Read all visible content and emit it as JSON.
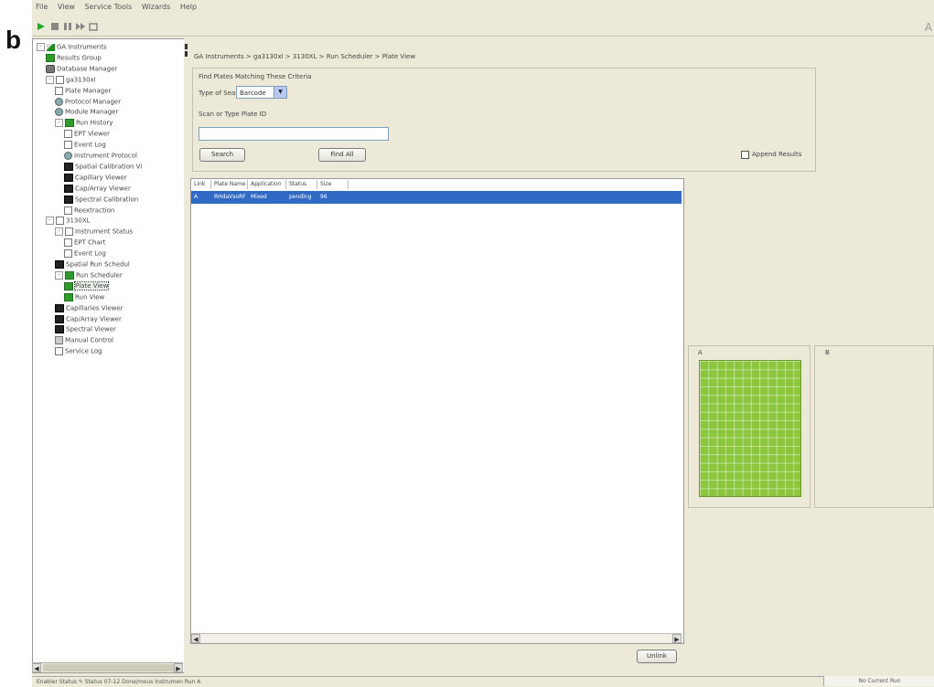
{
  "figure_label": "b",
  "menu": [
    "File",
    "View",
    "Service Tools",
    "Wizards",
    "Help"
  ],
  "toolbar": {
    "brand": "A",
    "icons": [
      "play-icon",
      "stop-icon",
      "pause-icon",
      "skip-icon",
      "clear-icon"
    ]
  },
  "tree": [
    {
      "label": "GA Instruments",
      "level": 0,
      "exp": "-",
      "icon": "tri"
    },
    {
      "label": "Results Group",
      "level": 1,
      "icon": "grn"
    },
    {
      "label": "Database Manager",
      "level": 1,
      "icon": "db"
    },
    {
      "label": "ga3130xl",
      "level": 1,
      "exp": "-",
      "icon": "doc"
    },
    {
      "label": "Plate Manager",
      "level": 2,
      "icon": "doc"
    },
    {
      "label": "Protocol Manager",
      "level": 2,
      "icon": "gear"
    },
    {
      "label": "Module Manager",
      "level": 2,
      "icon": "gear"
    },
    {
      "label": "Run History",
      "level": 2,
      "exp": "-",
      "icon": "grn"
    },
    {
      "label": "EPT Viewer",
      "level": 3,
      "icon": "doc"
    },
    {
      "label": "Event Log",
      "level": 3,
      "icon": "doc"
    },
    {
      "label": "Instrument Protocol",
      "level": 3,
      "icon": "gear"
    },
    {
      "label": "Spatial Calibration Vi",
      "level": 3,
      "icon": "blk"
    },
    {
      "label": "Capillary Viewer",
      "level": 3,
      "icon": "blk"
    },
    {
      "label": "Cap/Array Viewer",
      "level": 3,
      "icon": "blk"
    },
    {
      "label": "Spectral Calibration",
      "level": 3,
      "icon": "blk"
    },
    {
      "label": "Reextraction",
      "level": 3,
      "icon": "doc"
    },
    {
      "label": "3130XL",
      "level": 1,
      "exp": "-",
      "icon": "doc"
    },
    {
      "label": "Instrument Status",
      "level": 2,
      "exp": "-",
      "icon": "doc"
    },
    {
      "label": "EPT Chart",
      "level": 3,
      "icon": "doc"
    },
    {
      "label": "Event Log",
      "level": 3,
      "icon": "doc"
    },
    {
      "label": "Spatial Run Schedul",
      "level": 2,
      "icon": "blk"
    },
    {
      "label": "Run Scheduler",
      "level": 2,
      "exp": "-",
      "icon": "grn"
    },
    {
      "label": "Plate View",
      "level": 3,
      "icon": "grn",
      "selected": true
    },
    {
      "label": "Run View",
      "level": 3,
      "icon": "grn"
    },
    {
      "label": "Capillaries Viewer",
      "level": 2,
      "icon": "blk"
    },
    {
      "label": "Cap/Array Viewer",
      "level": 2,
      "icon": "blk"
    },
    {
      "label": "Spectral Viewer",
      "level": 2,
      "icon": "blk"
    },
    {
      "label": "Manual Control",
      "level": 2,
      "icon": "hand"
    },
    {
      "label": "Service Log",
      "level": 2,
      "icon": "doc"
    }
  ],
  "breadcrumb": "GA Instruments > ga3130xl > 3130XL > Run Scheduler > Plate View",
  "criteria": {
    "title": "Find Plates Matching These Criteria",
    "search_type_label": "Type of Search:",
    "search_type_value": "Barcode",
    "plate_id_label": "Scan or Type Plate ID",
    "plate_id_value": "",
    "search_button": "Search",
    "find_all_button": "Find All",
    "append_results_label": "Append Results",
    "append_results_checked": false
  },
  "table": {
    "columns": [
      "Link",
      "Plate Name",
      "Application",
      "Status",
      "Size"
    ],
    "rows": [
      [
        "A",
        "RHdaVsoRF",
        "Mixed",
        "pending",
        "96"
      ]
    ],
    "selected_row": 0
  },
  "unlink_button": "Unlink",
  "plates": {
    "a_label": "A",
    "b_label": "B"
  },
  "statusbar": {
    "left": "Enabler Status ✎   Status 07-12 Done/mous Instrumen Run A",
    "right": "No Current Run"
  }
}
